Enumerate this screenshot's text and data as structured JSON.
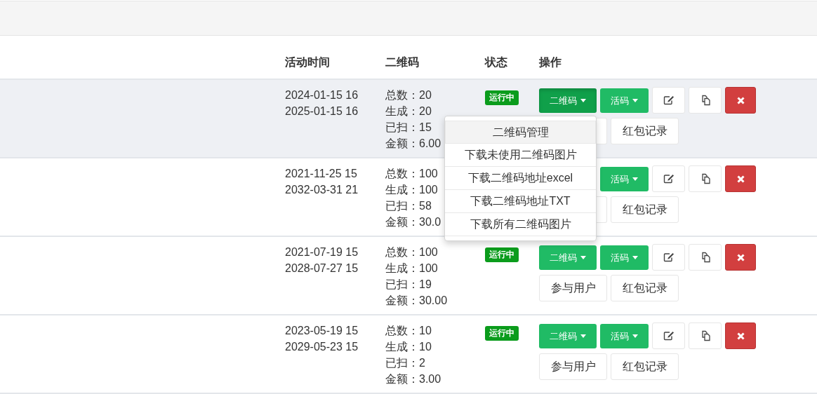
{
  "table": {
    "columns": [
      "活动时间",
      "二维码",
      "状态",
      "操作"
    ],
    "rows": [
      {
        "highlighted": true,
        "times": [
          "2024-01-15 16",
          "2025-01-15 16"
        ],
        "qr_stats": [
          "总数：20",
          "生成：20",
          "已扫：15",
          "金额：6.00"
        ],
        "status": "运行中",
        "qr_button": {
          "label": "二维码",
          "open": true
        },
        "live_button": "活码",
        "redpacket_button": "红包记录"
      },
      {
        "highlighted": false,
        "times": [
          "2021-11-25 15",
          "2032-03-31 21"
        ],
        "qr_stats": [
          "总数：100",
          "生成：100",
          "已扫：58",
          "金额：30.0"
        ],
        "live_button": "活码",
        "redpacket_button": "红包记录"
      },
      {
        "highlighted": false,
        "times": [
          "2021-07-19 15",
          "2028-07-27 15"
        ],
        "qr_stats": [
          "总数：100",
          "生成：100",
          "已扫：19",
          "金额：30.00"
        ],
        "status": "运行中",
        "qr_button": {
          "label": "二维码",
          "open": false
        },
        "live_button": "活码",
        "users_button": "参与用户",
        "redpacket_button": "红包记录"
      },
      {
        "highlighted": false,
        "times": [
          "2023-05-19 15",
          "2029-05-23 15"
        ],
        "qr_stats": [
          "总数：10",
          "生成：10",
          "已扫：2",
          "金额：3.00"
        ],
        "status": "运行中",
        "qr_button": {
          "label": "二维码",
          "open": false
        },
        "live_button": "活码",
        "users_button": "参与用户",
        "redpacket_button": "红包记录"
      }
    ]
  },
  "qr_menu": {
    "items": [
      {
        "label": "二维码管理",
        "selected": true
      },
      {
        "label": "下载未使用二维码图片",
        "selected": false
      },
      {
        "label": "下载二维码地址excel",
        "selected": false
      },
      {
        "label": "下载二维码地址TXT",
        "selected": false
      },
      {
        "label": "下载所有二维码图片",
        "selected": false
      }
    ]
  }
}
